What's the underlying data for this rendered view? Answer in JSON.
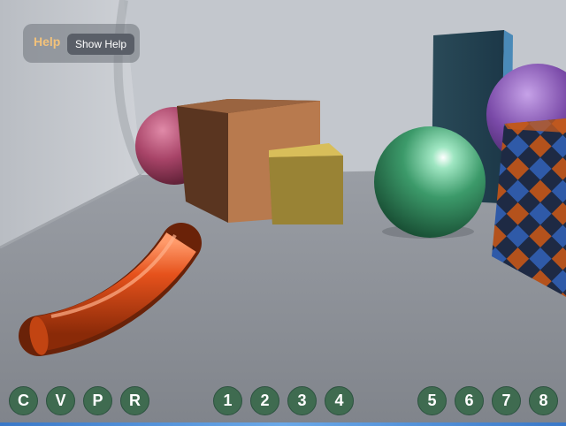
{
  "help": {
    "title": "Help",
    "button_label": "Show Help"
  },
  "mode_buttons": [
    {
      "label": "C"
    },
    {
      "label": "V"
    },
    {
      "label": "P"
    },
    {
      "label": "R"
    }
  ],
  "view_buttons_a": [
    {
      "label": "1"
    },
    {
      "label": "2"
    },
    {
      "label": "3"
    },
    {
      "label": "4"
    }
  ],
  "view_buttons_b": [
    {
      "label": "5"
    },
    {
      "label": "6"
    },
    {
      "label": "7"
    },
    {
      "label": "8"
    }
  ],
  "colors": {
    "button_fill": "#3f6b50",
    "help_title": "#f3c27a",
    "floor": "#8b8f97",
    "wall": "#c9cdd3"
  }
}
